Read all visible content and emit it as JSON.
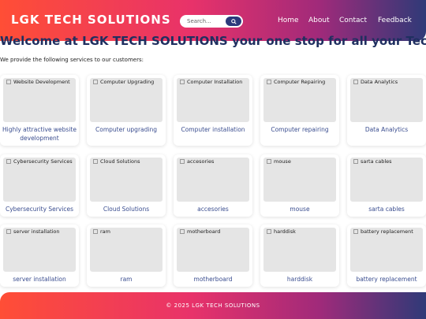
{
  "header": {
    "brand": "LGK TECH SOLUTIONS",
    "search_placeholder": "Search...",
    "nav": [
      "Home",
      "About",
      "Contact",
      "Feedback"
    ]
  },
  "main": {
    "welcome": "Welcome at LGK TECH SOLUTIONS your one stop for all your Tech problems",
    "intro": "We provide the following services to our customers:"
  },
  "services": [
    {
      "alt": "Website Development",
      "title": "Highly attractive website development"
    },
    {
      "alt": "Computer Upgrading",
      "title": "Computer upgrading"
    },
    {
      "alt": "Computer Installation",
      "title": "Computer installation"
    },
    {
      "alt": "Computer Repairing",
      "title": "Computer repairing"
    },
    {
      "alt": "Data Analytics",
      "title": "Data Analytics"
    },
    {
      "alt": "Cybersecurity Services",
      "title": "Cybersecurity Services"
    },
    {
      "alt": "Cloud Solutions",
      "title": "Cloud Solutions"
    },
    {
      "alt": "accesories",
      "title": "accesories"
    },
    {
      "alt": "mouse",
      "title": "mouse"
    },
    {
      "alt": "sarta cables",
      "title": "sarta cables"
    },
    {
      "alt": "server installation",
      "title": "server installation"
    },
    {
      "alt": "ram",
      "title": "ram"
    },
    {
      "alt": "motherboard",
      "title": "motherboard"
    },
    {
      "alt": "harddisk",
      "title": "harddisk"
    },
    {
      "alt": "battery replacement",
      "title": "battery replacement"
    }
  ],
  "footer": {
    "text": "© 2025 LGK TECH SOLUTIONS"
  },
  "colors": {
    "gradient_start": "#ff4e36",
    "gradient_mid": "#e8326a",
    "gradient_end": "#2f3a78",
    "heading": "#1f2f60",
    "card_title": "#3a4d8f"
  }
}
